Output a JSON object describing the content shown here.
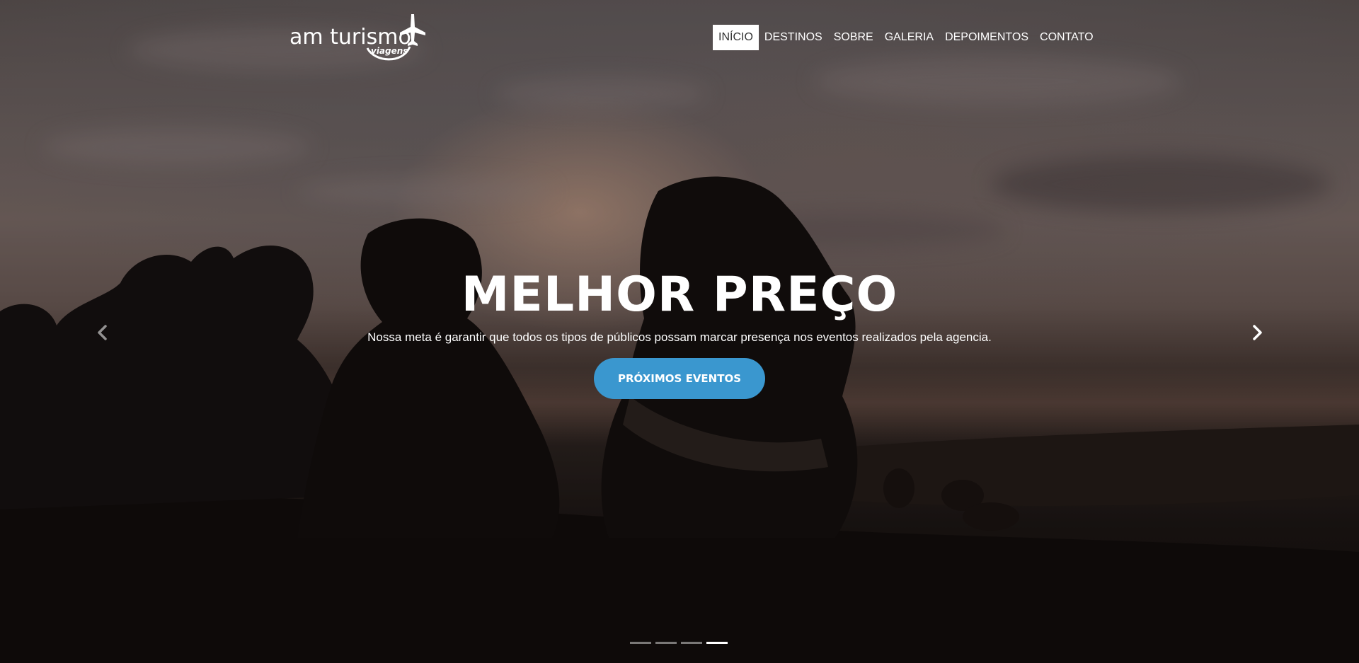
{
  "brand": {
    "logo_text": "am turismo",
    "logo_subtext": "viagens"
  },
  "nav": {
    "items": [
      {
        "label": "INÍCIO",
        "active": true
      },
      {
        "label": "DESTINOS",
        "active": false
      },
      {
        "label": "SOBRE",
        "active": false
      },
      {
        "label": "GALERIA",
        "active": false
      },
      {
        "label": "DEPOIMENTOS",
        "active": false
      },
      {
        "label": "CONTATO",
        "active": false
      }
    ]
  },
  "slide": {
    "title": "MELHOR PREÇO",
    "subtitle": "Nossa meta é garantir que todos os tipos de públicos possam marcar presença nos eventos realizados pela agencia.",
    "cta_label": "PRÓXIMOS EVENTOS"
  },
  "carousel": {
    "prev_icon": "chevron-left-icon",
    "next_icon": "chevron-right-icon",
    "slide_count": 4,
    "active_index": 3
  },
  "colors": {
    "accent": "#3a97cf",
    "nav_active_bg": "#ffffff",
    "nav_active_text": "#333333",
    "text": "#ffffff"
  }
}
